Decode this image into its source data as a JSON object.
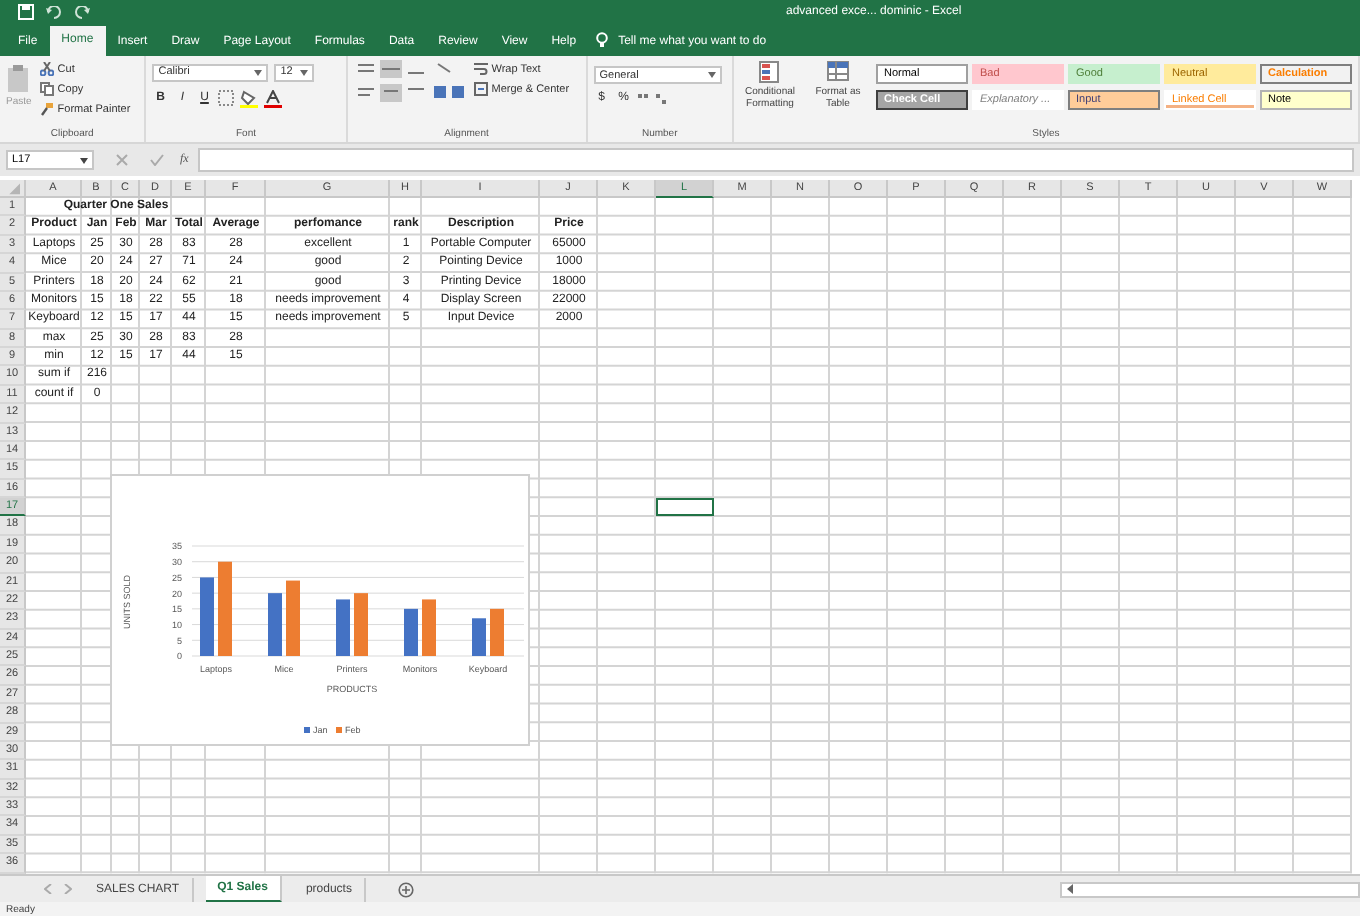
{
  "window": {
    "title": "advanced exce... dominic  -  Excel"
  },
  "menu_tabs": [
    {
      "label": "File",
      "selected": false
    },
    {
      "label": "Home",
      "selected": true
    },
    {
      "label": "Insert",
      "selected": false
    },
    {
      "label": "Draw",
      "selected": false
    },
    {
      "label": "Page Layout",
      "selected": false
    },
    {
      "label": "Formulas",
      "selected": false
    },
    {
      "label": "Data",
      "selected": false
    },
    {
      "label": "Review",
      "selected": false
    },
    {
      "label": "View",
      "selected": false
    },
    {
      "label": "Help",
      "selected": false
    }
  ],
  "tell_me": {
    "placeholder": "Tell me what you want to do"
  },
  "ribbon": {
    "clipboard": {
      "label": "Clipboard",
      "paste": "Paste",
      "cut": "Cut",
      "copy": "Copy",
      "format_painter": "Format Painter"
    },
    "font": {
      "label": "Font",
      "family": "Calibri",
      "size": "12",
      "buttons": [
        "B",
        "I",
        "U"
      ]
    },
    "alignment": {
      "label": "Alignment",
      "wrap": "Wrap Text",
      "merge": "Merge & Center"
    },
    "number": {
      "label": "Number",
      "format": "General",
      "buttons": [
        "$",
        "%"
      ]
    },
    "styles": {
      "label": "Styles",
      "conditional": "Conditional Formatting",
      "format_table": "Format as Table",
      "cells": [
        {
          "label": "Normal",
          "kind": "normal"
        },
        {
          "label": "Bad",
          "kind": "bad"
        },
        {
          "label": "Good",
          "kind": "good"
        },
        {
          "label": "Neutral",
          "kind": "neutral"
        },
        {
          "label": "Calculation",
          "kind": "calculation"
        },
        {
          "label": "Check Cell",
          "kind": "check"
        },
        {
          "label": "Explanatory ...",
          "kind": "explanatory"
        },
        {
          "label": "Input",
          "kind": "input"
        },
        {
          "label": "Linked Cell",
          "kind": "linked"
        },
        {
          "label": "Note",
          "kind": "note"
        }
      ]
    }
  },
  "formula_bar": {
    "name_box": "L17",
    "function_label": "fx"
  },
  "sheet": {
    "columns": [
      {
        "label": "A",
        "selected": false
      },
      {
        "label": "B",
        "selected": false
      },
      {
        "label": "C",
        "selected": false
      },
      {
        "label": "D",
        "selected": false
      },
      {
        "label": "E",
        "selected": false
      },
      {
        "label": "F",
        "selected": false
      },
      {
        "label": "G",
        "selected": false
      },
      {
        "label": "H",
        "selected": false
      },
      {
        "label": "I",
        "selected": false
      },
      {
        "label": "J",
        "selected": false
      },
      {
        "label": "K",
        "selected": false
      },
      {
        "label": "L",
        "selected": true
      },
      {
        "label": "M",
        "selected": false
      },
      {
        "label": "N",
        "selected": false
      },
      {
        "label": "O",
        "selected": false
      },
      {
        "label": "P",
        "selected": false
      },
      {
        "label": "Q",
        "selected": false
      },
      {
        "label": "R",
        "selected": false
      },
      {
        "label": "S",
        "selected": false
      },
      {
        "label": "T",
        "selected": false
      },
      {
        "label": "U",
        "selected": false
      },
      {
        "label": "V",
        "selected": false
      },
      {
        "label": "W",
        "selected": false
      }
    ],
    "rows": [
      {
        "header": "1",
        "selected": false,
        "kind": "title",
        "title": "Quarter One  Sales"
      },
      {
        "header": "2",
        "selected": false,
        "kind": "header",
        "cells": [
          "Product",
          "Jan",
          "Feb",
          "Mar",
          "Total",
          "Average",
          "perfomance",
          "rank",
          "Description",
          "Price"
        ]
      },
      {
        "header": "3",
        "selected": false,
        "kind": "data",
        "cells": [
          "Laptops",
          "25",
          "30",
          "28",
          "83",
          "28",
          "excellent",
          "1",
          "Portable Computer",
          "65000"
        ]
      },
      {
        "header": "4",
        "selected": false,
        "kind": "data",
        "cells": [
          "Mice",
          "20",
          "24",
          "27",
          "71",
          "24",
          "good",
          "2",
          "Pointing Device",
          "1000"
        ]
      },
      {
        "header": "5",
        "selected": false,
        "kind": "data",
        "cells": [
          "Printers",
          "18",
          "20",
          "24",
          "62",
          "21",
          "good",
          "3",
          "Printing Device",
          "18000"
        ]
      },
      {
        "header": "6",
        "selected": false,
        "kind": "data",
        "cells": [
          "Monitors",
          "15",
          "18",
          "22",
          "55",
          "18",
          "needs improvement",
          "4",
          "Display Screen",
          "22000"
        ]
      },
      {
        "header": "7",
        "selected": false,
        "kind": "data",
        "cells": [
          "Keyboard",
          "12",
          "15",
          "17",
          "44",
          "15",
          "needs improvement",
          "5",
          "Input Device",
          "2000"
        ]
      },
      {
        "header": "8",
        "selected": false,
        "kind": "data",
        "cells": [
          "max",
          "25",
          "30",
          "28",
          "83",
          "28"
        ]
      },
      {
        "header": "9",
        "selected": false,
        "kind": "data",
        "cells": [
          "min",
          "12",
          "15",
          "17",
          "44",
          "15"
        ]
      },
      {
        "header": "10",
        "selected": false,
        "kind": "data",
        "cells": [
          "sum if",
          "216"
        ]
      },
      {
        "header": "11",
        "selected": false,
        "kind": "data",
        "cells": [
          "count if",
          "0"
        ]
      },
      {
        "header": "12",
        "selected": false
      },
      {
        "header": "13",
        "selected": false
      },
      {
        "header": "14",
        "selected": false
      },
      {
        "header": "15",
        "selected": false
      },
      {
        "header": "16",
        "selected": false
      },
      {
        "header": "17",
        "selected": true
      },
      {
        "header": "18",
        "selected": false
      },
      {
        "header": "19",
        "selected": false
      },
      {
        "header": "20",
        "selected": false
      },
      {
        "header": "21",
        "selected": false
      },
      {
        "header": "22",
        "selected": false
      },
      {
        "header": "23",
        "selected": false
      },
      {
        "header": "24",
        "selected": false
      },
      {
        "header": "25",
        "selected": false
      },
      {
        "header": "26",
        "selected": false
      },
      {
        "header": "27",
        "selected": false
      },
      {
        "header": "28",
        "selected": false
      },
      {
        "header": "29",
        "selected": false
      },
      {
        "header": "30",
        "selected": false
      },
      {
        "header": "31",
        "selected": false
      },
      {
        "header": "32",
        "selected": false
      },
      {
        "header": "33",
        "selected": false
      },
      {
        "header": "34",
        "selected": false
      },
      {
        "header": "35",
        "selected": false
      },
      {
        "header": "36",
        "selected": false
      }
    ]
  },
  "chart": {
    "chart_data": {
      "type": "bar",
      "xlabel": "PRODUCTS",
      "ylabel": "UNITS SOLD",
      "categories": [
        "Laptops",
        "Mice",
        "Printers",
        "Monitors",
        "Keyboard"
      ],
      "series": [
        {
          "name": "Jan",
          "color": "#4472c4",
          "values": [
            25,
            20,
            18,
            15,
            12
          ]
        },
        {
          "name": "Feb",
          "color": "#ed7d31",
          "values": [
            30,
            24,
            20,
            18,
            15
          ]
        }
      ],
      "ylim": [
        0,
        35
      ],
      "yticks": [
        0,
        5,
        10,
        15,
        20,
        25,
        30,
        35
      ],
      "grid": true,
      "legend": true
    }
  },
  "sheet_tabs": [
    {
      "label": "SALES CHART",
      "selected": false
    },
    {
      "label": "Q1 Sales",
      "selected": true
    },
    {
      "label": "products",
      "selected": false
    }
  ],
  "status_bar": {
    "text": "Ready"
  }
}
